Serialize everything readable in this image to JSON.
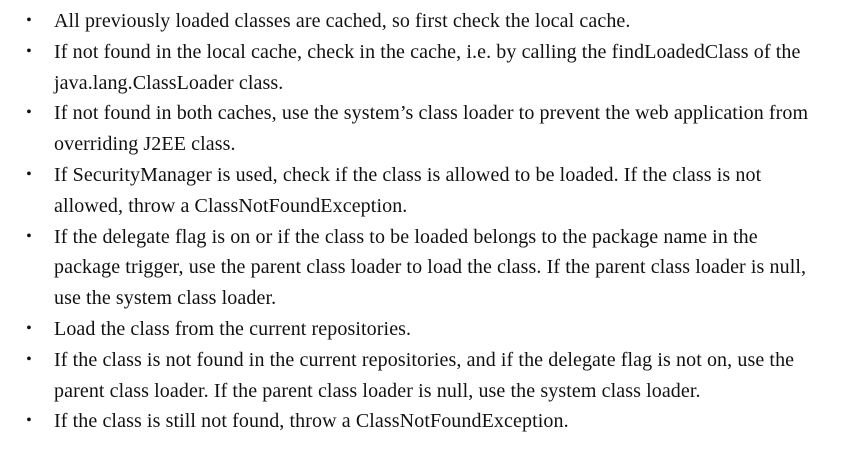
{
  "bullet_symbol": "•",
  "items": [
    {
      "text": "All previously loaded classes are cached, so first check the local cache."
    },
    {
      "text": "If not found in the local cache, check in the cache, i.e. by calling the findLoadedClass of the java.lang.ClassLoader class."
    },
    {
      "text": "If not found in both caches, use the system’s class loader to prevent the web application from overriding J2EE class."
    },
    {
      "text": "If SecurityManager is used, check if the class is allowed to be loaded. If the class is not allowed, throw a ClassNotFoundException."
    },
    {
      "text": "If the delegate flag is on or if the class to be loaded belongs to the package name in the package trigger, use the parent class loader to load the class. If the parent class loader is null, use the system class loader."
    },
    {
      "text": "Load the class from the current repositories."
    },
    {
      "text": "If the class is not found in the current repositories, and if the delegate flag is not on, use the parent class loader. If the parent class loader is null, use the system class loader."
    },
    {
      "text": "If the class is still not found, throw a ClassNotFoundException."
    }
  ]
}
